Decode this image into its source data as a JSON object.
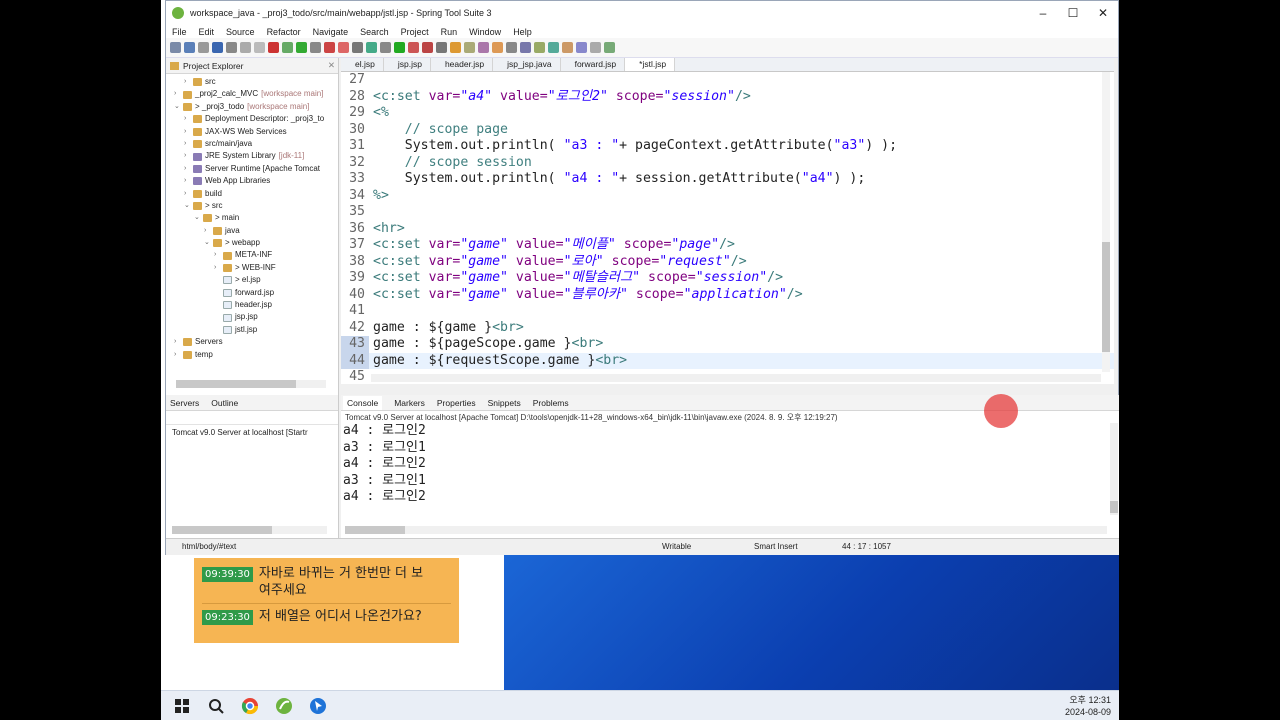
{
  "window": {
    "title": "workspace_java - _proj3_todo/src/main/webapp/jstl.jsp - Spring Tool Suite 3"
  },
  "menu": [
    "File",
    "Edit",
    "Source",
    "Refactor",
    "Navigate",
    "Search",
    "Project",
    "Run",
    "Window",
    "Help"
  ],
  "project_explorer": {
    "title": "Project Explorer",
    "items": [
      {
        "label": "src",
        "indent": 1,
        "arrow": ">",
        "dim": ""
      },
      {
        "label": "_proj2_calc_MVC",
        "indent": 0,
        "arrow": ">",
        "dim": " [workspace main]"
      },
      {
        "label": "> _proj3_todo",
        "indent": 0,
        "arrow": "v",
        "dim": " [workspace main]"
      },
      {
        "label": "Deployment Descriptor: _proj3_to",
        "indent": 1,
        "arrow": ">",
        "dim": ""
      },
      {
        "label": "JAX-WS Web Services",
        "indent": 1,
        "arrow": ">",
        "dim": ""
      },
      {
        "label": "src/main/java",
        "indent": 1,
        "arrow": ">",
        "dim": ""
      },
      {
        "label": "JRE System Library",
        "indent": 1,
        "arrow": ">",
        "dim": " [jdk-11]"
      },
      {
        "label": "Server Runtime [Apache Tomcat",
        "indent": 1,
        "arrow": ">",
        "dim": ""
      },
      {
        "label": "Web App Libraries",
        "indent": 1,
        "arrow": ">",
        "dim": ""
      },
      {
        "label": "build",
        "indent": 1,
        "arrow": ">",
        "dim": ""
      },
      {
        "label": "> src",
        "indent": 1,
        "arrow": "v",
        "dim": ""
      },
      {
        "label": "> main",
        "indent": 2,
        "arrow": "v",
        "dim": ""
      },
      {
        "label": "java",
        "indent": 3,
        "arrow": ">",
        "dim": ""
      },
      {
        "label": "> webapp",
        "indent": 3,
        "arrow": "v",
        "dim": ""
      },
      {
        "label": "META-INF",
        "indent": 4,
        "arrow": ">",
        "dim": ""
      },
      {
        "label": "> WEB-INF",
        "indent": 4,
        "arrow": ">",
        "dim": ""
      },
      {
        "label": "> el.jsp",
        "indent": 4,
        "arrow": "",
        "dim": ""
      },
      {
        "label": "forward.jsp",
        "indent": 4,
        "arrow": "",
        "dim": ""
      },
      {
        "label": "header.jsp",
        "indent": 4,
        "arrow": "",
        "dim": ""
      },
      {
        "label": "jsp.jsp",
        "indent": 4,
        "arrow": "",
        "dim": ""
      },
      {
        "label": "jstl.jsp",
        "indent": 4,
        "arrow": "",
        "dim": ""
      },
      {
        "label": "Servers",
        "indent": 0,
        "arrow": ">",
        "dim": ""
      },
      {
        "label": "temp",
        "indent": 0,
        "arrow": ">",
        "dim": ""
      }
    ]
  },
  "editor": {
    "tabs": [
      "el.jsp",
      "jsp.jsp",
      "header.jsp",
      "jsp_jsp.java",
      "forward.jsp",
      "*jstl.jsp"
    ],
    "active_tab": 5,
    "lines": [
      {
        "n": "27",
        "segs": []
      },
      {
        "n": "28",
        "segs": [
          [
            "el",
            "<c:set "
          ],
          [
            "att",
            "var="
          ],
          [
            "str",
            "\"a4\""
          ],
          [
            "att",
            " value="
          ],
          [
            "str",
            "\"로그인2\""
          ],
          [
            "att",
            " scope="
          ],
          [
            "str",
            "\"session\""
          ],
          [
            "el",
            "/>"
          ]
        ]
      },
      {
        "n": "29",
        "segs": [
          [
            "el",
            "<%"
          ]
        ]
      },
      {
        "n": "30",
        "segs": [
          [
            "txt",
            "    "
          ],
          [
            "com",
            "// scope page"
          ]
        ]
      },
      {
        "n": "31",
        "segs": [
          [
            "txt",
            "    System.out.println( "
          ],
          [
            "str2",
            "\"a3 : \""
          ],
          [
            "txt",
            "+ pageContext.getAttribute("
          ],
          [
            "str2",
            "\"a3\""
          ],
          [
            "txt",
            ") );"
          ]
        ]
      },
      {
        "n": "32",
        "segs": [
          [
            "txt",
            "    "
          ],
          [
            "com",
            "// scope session"
          ]
        ]
      },
      {
        "n": "33",
        "segs": [
          [
            "txt",
            "    System.out.println( "
          ],
          [
            "str2",
            "\"a4 : \""
          ],
          [
            "txt",
            "+ session.getAttribute("
          ],
          [
            "str2",
            "\"a4\""
          ],
          [
            "txt",
            ") );"
          ]
        ]
      },
      {
        "n": "34",
        "segs": [
          [
            "el",
            "%>"
          ]
        ]
      },
      {
        "n": "35",
        "segs": []
      },
      {
        "n": "36",
        "segs": [
          [
            "el",
            "<hr>"
          ]
        ]
      },
      {
        "n": "37",
        "segs": [
          [
            "el",
            "<c:set "
          ],
          [
            "att",
            "var="
          ],
          [
            "str",
            "\"game\""
          ],
          [
            "att",
            " value="
          ],
          [
            "str",
            "\"메이플\""
          ],
          [
            "att",
            " scope="
          ],
          [
            "str",
            "\"page\""
          ],
          [
            "el",
            "/>"
          ]
        ]
      },
      {
        "n": "38",
        "segs": [
          [
            "el",
            "<c:set "
          ],
          [
            "att",
            "var="
          ],
          [
            "str",
            "\"game\""
          ],
          [
            "att",
            " value="
          ],
          [
            "str",
            "\"로아\""
          ],
          [
            "att",
            " scope="
          ],
          [
            "str",
            "\"request\""
          ],
          [
            "el",
            "/>"
          ]
        ]
      },
      {
        "n": "39",
        "segs": [
          [
            "el",
            "<c:set "
          ],
          [
            "att",
            "var="
          ],
          [
            "str",
            "\"game\""
          ],
          [
            "att",
            " value="
          ],
          [
            "str",
            "\"메탈슬러그\""
          ],
          [
            "att",
            " scope="
          ],
          [
            "str",
            "\"session\""
          ],
          [
            "el",
            "/>"
          ]
        ]
      },
      {
        "n": "40",
        "segs": [
          [
            "el",
            "<c:set "
          ],
          [
            "att",
            "var="
          ],
          [
            "str",
            "\"game\""
          ],
          [
            "att",
            " value="
          ],
          [
            "str",
            "\"블루아카\""
          ],
          [
            "att",
            " scope="
          ],
          [
            "str",
            "\"application\""
          ],
          [
            "el",
            "/>"
          ]
        ]
      },
      {
        "n": "41",
        "segs": []
      },
      {
        "n": "42",
        "segs": [
          [
            "txt",
            "game : ${game }"
          ],
          [
            "el",
            "<br>"
          ]
        ]
      },
      {
        "n": "43",
        "segs": [
          [
            "txt",
            "game : ${pageScope.game }"
          ],
          [
            "el",
            "<br>"
          ]
        ]
      },
      {
        "n": "44",
        "segs": [
          [
            "txt",
            "game : ${requestScope.game }"
          ],
          [
            "el",
            "<br>"
          ]
        ]
      },
      {
        "n": "45",
        "segs": []
      }
    ]
  },
  "servers_panel": {
    "tab1": "Servers",
    "tab2": "Outline",
    "entry": "Tomcat v9.0 Server at localhost  [Startr"
  },
  "console": {
    "tabs": [
      "Console",
      "Markers",
      "Properties",
      "Snippets",
      "Problems"
    ],
    "info": "Tomcat v9.0 Server at localhost [Apache Tomcat] D:\\tools\\openjdk-11+28_windows-x64_bin\\jdk-11\\bin\\javaw.exe  (2024. 8. 9. 오후 12:19:27)",
    "lines": [
      "a4 : 로그인2",
      "a3 : 로그인1",
      "a4 : 로그인2",
      "a3 : 로그인1",
      "a4 : 로그인2"
    ]
  },
  "status": {
    "path": "html/body/#text",
    "mode": "Writable",
    "insert": "Smart Insert",
    "pos": "44 : 17 : 1057"
  },
  "chat": [
    {
      "time": "09:39:30",
      "msg": "자바로 바뀌는 거 한번만 더 보여주세요"
    },
    {
      "time": "09:23:30",
      "msg": "저 배열은 어디서 나온건가요?"
    }
  ],
  "clock": {
    "time": "오후 12:31",
    "date": "2024-08-09"
  },
  "colors": {
    "chat_bg": "#f6b553",
    "time_badge": "#2f9a49",
    "desktop": "#1b66d6",
    "pointer": "#e63c3c"
  }
}
